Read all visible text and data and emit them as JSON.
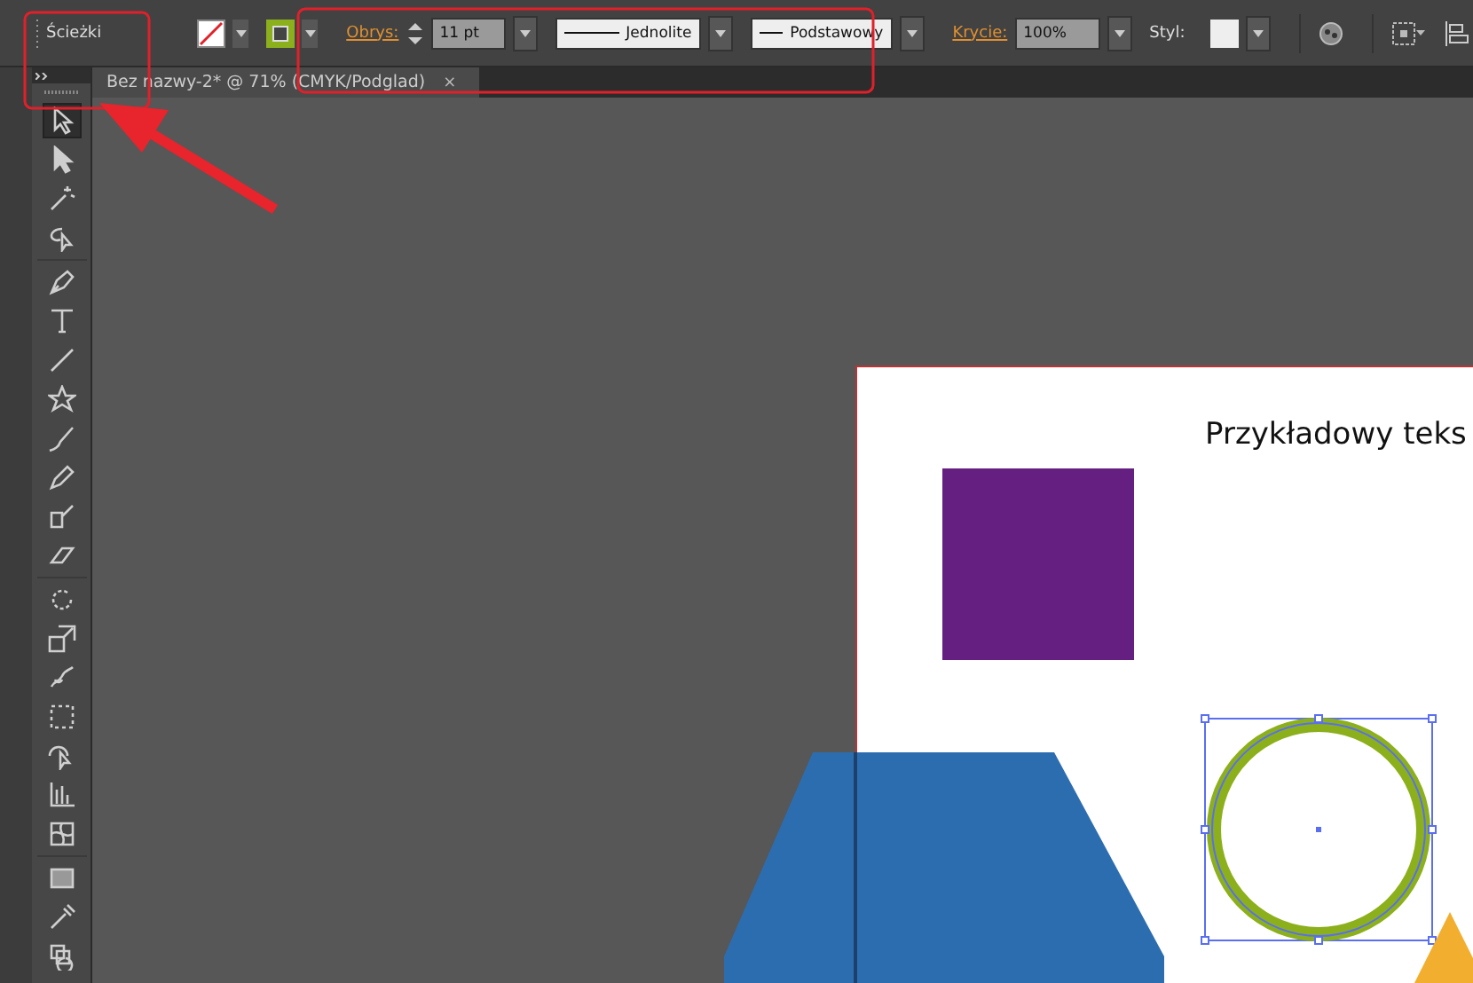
{
  "control_bar": {
    "path_label": "Ścieżki",
    "stroke_label": "Obrys:",
    "stroke_weight": "11 pt",
    "stroke_style": "Jednolite",
    "profile": "Podstawowy",
    "opacity_label": "Krycie:",
    "opacity": "100%",
    "style_label": "Styl:"
  },
  "document_tab": {
    "title": "Bez nazwy-2* @ 71% (CMYK/Podglad)",
    "close": "×"
  },
  "tools": [
    {
      "selected": true
    },
    {
      "selected": false
    },
    {
      "selected": false
    },
    {
      "selected": false
    },
    {
      "selected": false
    },
    {
      "selected": false
    },
    {
      "selected": false
    },
    {
      "selected": false
    },
    {
      "selected": false
    },
    {
      "selected": false
    },
    {
      "selected": false
    },
    {
      "selected": false
    },
    {
      "selected": false
    },
    {
      "selected": false
    },
    {
      "selected": false
    },
    {
      "selected": false
    },
    {
      "selected": false
    },
    {
      "selected": false
    },
    {
      "selected": false
    },
    {
      "selected": false
    },
    {
      "selected": false
    },
    {
      "selected": false
    }
  ],
  "artboard": {
    "text": "Przykładowy teks"
  }
}
